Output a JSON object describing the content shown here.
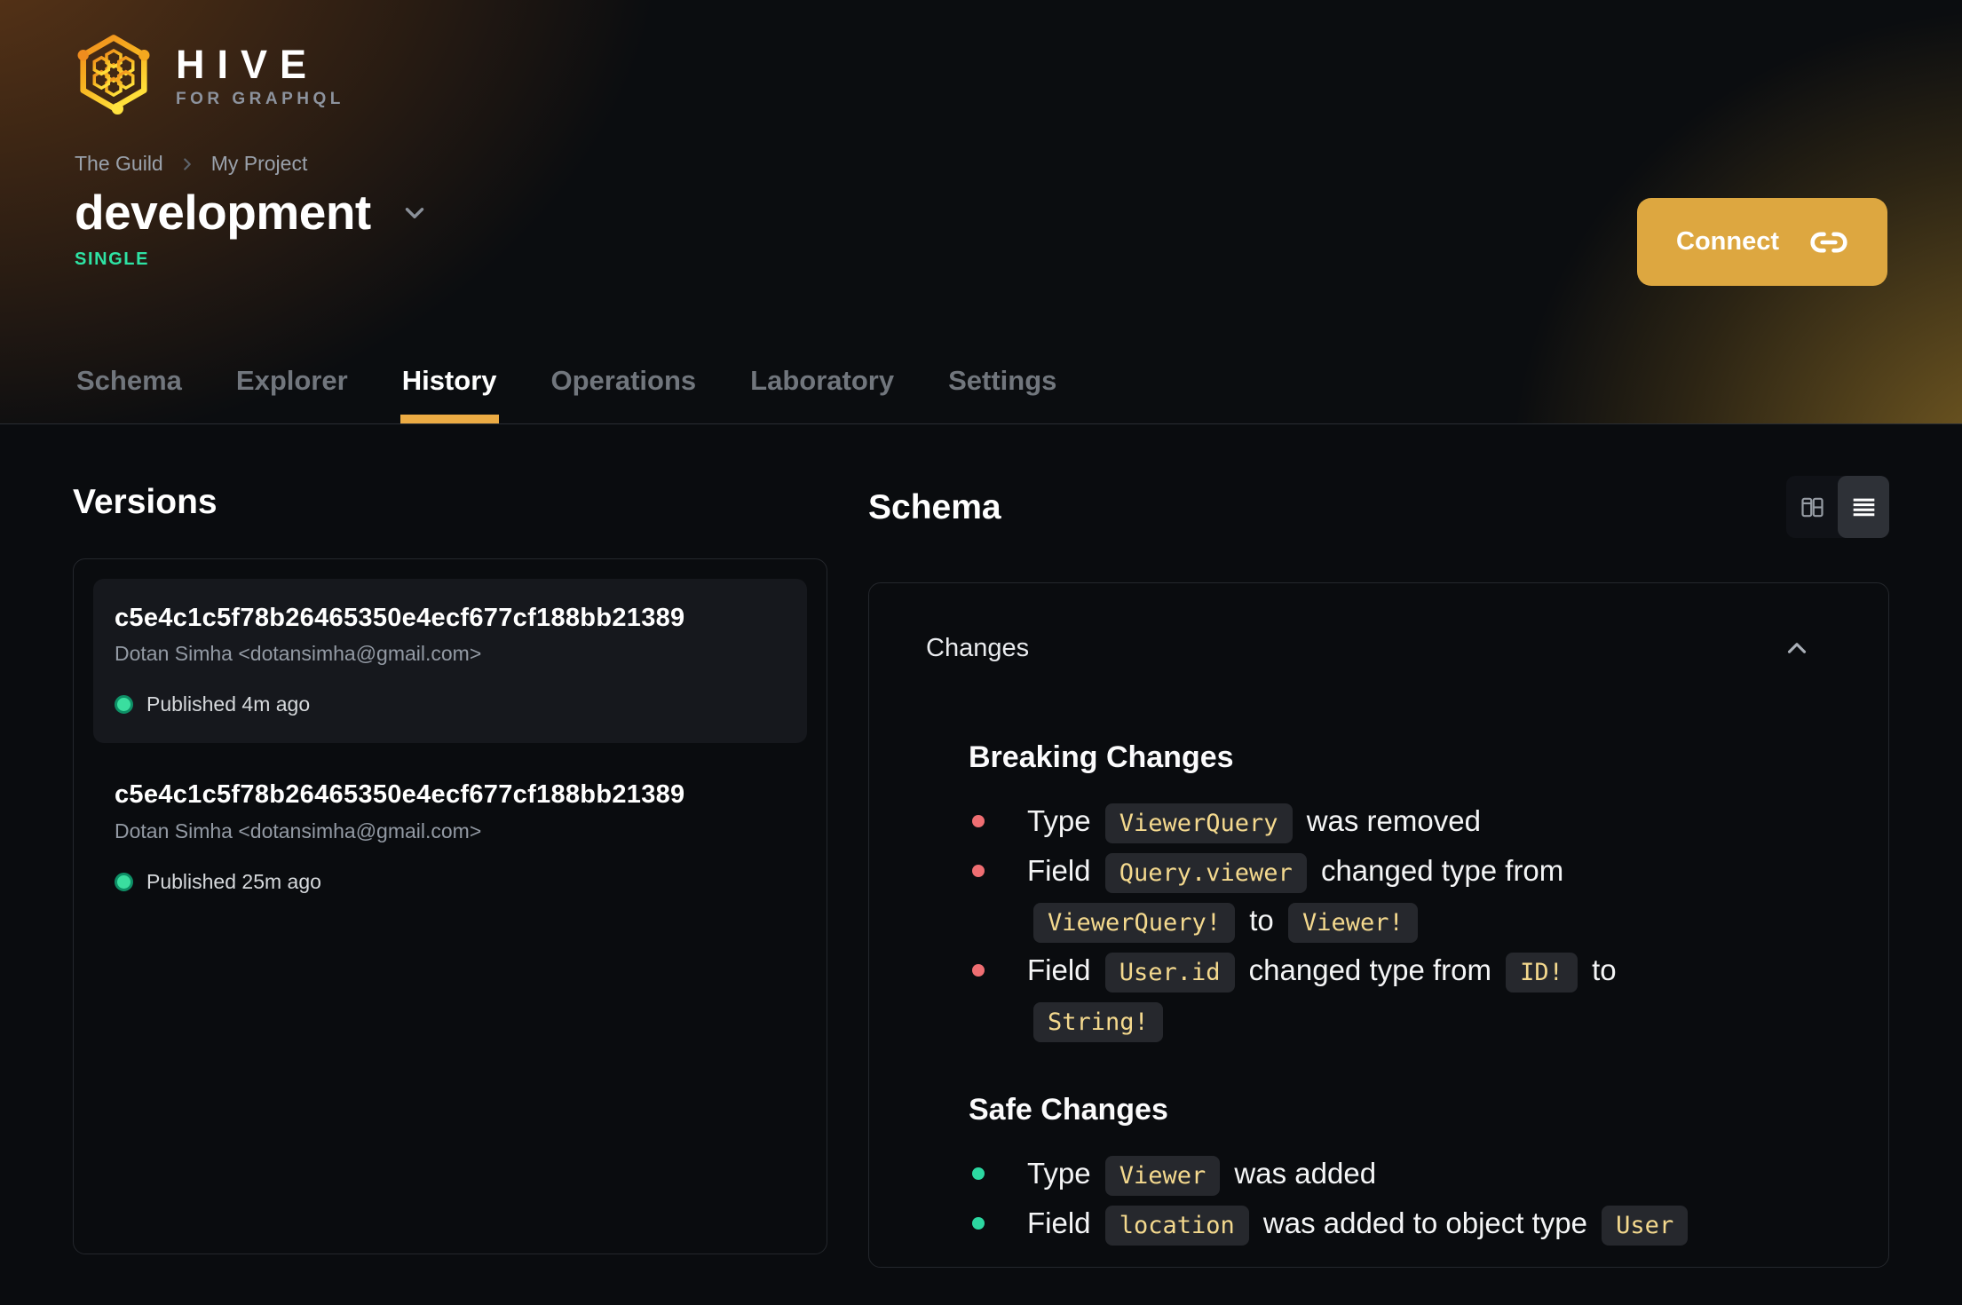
{
  "brand": {
    "name": "HIVE",
    "tagline": "FOR GRAPHQL"
  },
  "breadcrumb": {
    "org": "The Guild",
    "project": "My Project"
  },
  "target": {
    "name": "development",
    "badge": "SINGLE"
  },
  "connect": {
    "label": "Connect"
  },
  "tabs": [
    {
      "label": "Schema",
      "active": false
    },
    {
      "label": "Explorer",
      "active": false
    },
    {
      "label": "History",
      "active": true
    },
    {
      "label": "Operations",
      "active": false
    },
    {
      "label": "Laboratory",
      "active": false
    },
    {
      "label": "Settings",
      "active": false
    }
  ],
  "versions": {
    "heading": "Versions",
    "items": [
      {
        "hash": "c5e4c1c5f78b26465350e4ecf677cf188bb21389",
        "author": "Dotan Simha <dotansimha@gmail.com>",
        "status": "Published 4m ago",
        "selected": true
      },
      {
        "hash": "c5e4c1c5f78b26465350e4ecf677cf188bb21389",
        "author": "Dotan Simha <dotansimha@gmail.com>",
        "status": "Published 25m ago",
        "selected": false
      }
    ]
  },
  "schema": {
    "heading": "Schema",
    "view_toggle": {
      "options": [
        "diff-view",
        "list-view"
      ],
      "active": "list-view"
    },
    "changes": {
      "title": "Changes",
      "collapsed": false,
      "sections": [
        {
          "title": "Breaking Changes",
          "kind": "breaking",
          "items": [
            {
              "segments": [
                {
                  "text": "Type "
                },
                {
                  "code": "ViewerQuery"
                },
                {
                  "text": " was removed"
                }
              ]
            },
            {
              "segments": [
                {
                  "text": "Field "
                },
                {
                  "code": "Query.viewer"
                },
                {
                  "text": " changed type from "
                },
                {
                  "code": "ViewerQuery!"
                },
                {
                  "text": " to "
                },
                {
                  "code": "Viewer!"
                }
              ]
            },
            {
              "segments": [
                {
                  "text": "Field "
                },
                {
                  "code": "User.id"
                },
                {
                  "text": " changed type from "
                },
                {
                  "code": "ID!"
                },
                {
                  "text": " to "
                },
                {
                  "code": "String!"
                }
              ]
            }
          ]
        },
        {
          "title": "Safe Changes",
          "kind": "safe",
          "items": [
            {
              "segments": [
                {
                  "text": "Type "
                },
                {
                  "code": "Viewer"
                },
                {
                  "text": " was added"
                }
              ]
            },
            {
              "segments": [
                {
                  "text": "Field "
                },
                {
                  "code": "location"
                },
                {
                  "text": " was added to object type "
                },
                {
                  "code": "User"
                }
              ]
            }
          ]
        }
      ]
    }
  },
  "icons": {
    "logo": "hive-hexagon-honeycomb",
    "breadcrumb_separator": "chevron-right-icon",
    "target_selector": "chevron-down-icon",
    "connect": "link-icon",
    "view_diff": "columns-icon",
    "view_list": "list-icon",
    "changes_collapse": "chevron-up-icon",
    "published": "status-dot-green"
  },
  "colors": {
    "accent_amber": "#dda740",
    "tab_underline": "#ecab44",
    "badge_green": "#2ee3a4",
    "breaking_bullet": "#ef6e72",
    "safe_bullet": "#2cd8a1",
    "chip_text": "#f4d98e",
    "chip_bg": "#26282d"
  }
}
